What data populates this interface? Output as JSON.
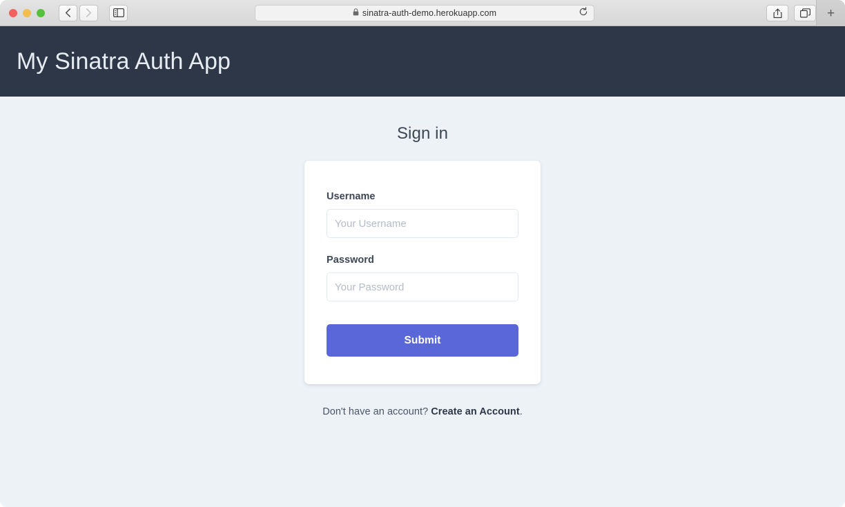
{
  "browser": {
    "window_controls": {
      "close_label": "close",
      "minimize_label": "minimize",
      "maximize_label": "maximize"
    },
    "nav": {
      "back_label": "Back",
      "forward_label": "Forward",
      "sidebar_label": "Show Sidebar"
    },
    "address_bar": {
      "url": "sinatra-auth-demo.herokuapp.com",
      "secure_icon": "lock-icon",
      "reload_icon": "reload-icon"
    },
    "actions": {
      "share_label": "Share",
      "tabs_overview_label": "Show Tab Overview",
      "new_tab_label": "+"
    }
  },
  "site": {
    "header": {
      "title": "My Sinatra Auth App",
      "background_color": "#2d3748",
      "text_color": "#e7ecf3"
    },
    "page": {
      "background_color": "#edf2f7",
      "heading": "Sign in"
    },
    "form": {
      "username": {
        "label": "Username",
        "placeholder": "Your Username",
        "value": ""
      },
      "password": {
        "label": "Password",
        "placeholder": "Your Password",
        "value": ""
      },
      "submit_label": "Submit",
      "submit_color": "#5a67d8"
    },
    "footer": {
      "prompt_text": "Don't have an account? ",
      "link_text": "Create an Account",
      "trailing_text": "."
    }
  }
}
